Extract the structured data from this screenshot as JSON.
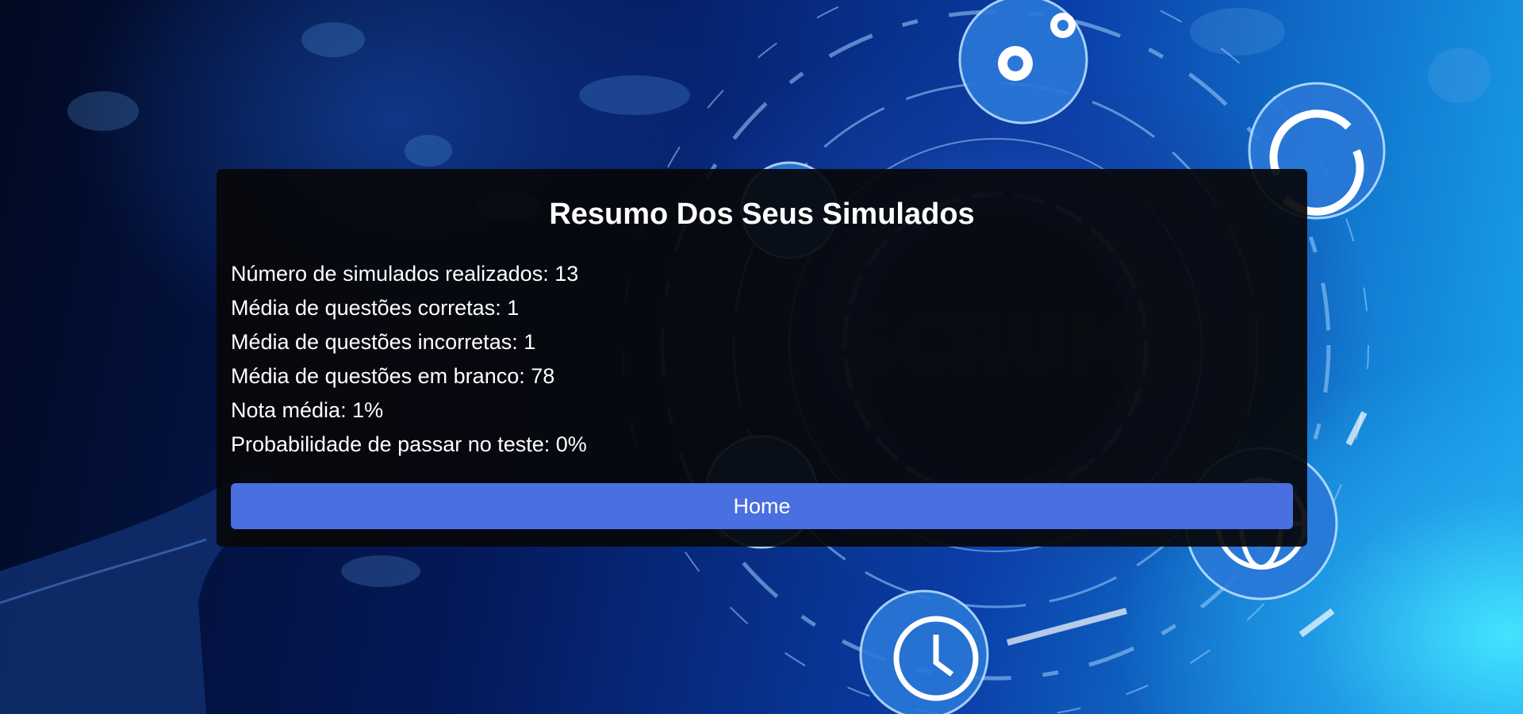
{
  "background": {
    "image_text": "SCRUM",
    "icons": [
      "gears-icon",
      "sync-icon",
      "rocket-icon",
      "globe-icon",
      "clock-icon",
      "pointing-hand"
    ]
  },
  "summary": {
    "title": "Resumo Dos Seus Simulados",
    "stats": [
      "Número de simulados realizados: 13",
      "Média de questões corretas: 1",
      "Média de questões incorretas: 1",
      "Média de questões em branco: 78",
      "Nota média: 1%",
      "Probabilidade de passar no teste: 0%"
    ],
    "home_label": "Home"
  },
  "colors": {
    "card_bg": "#08080a",
    "button": "#4a6fe0",
    "text": "#ffffff"
  }
}
